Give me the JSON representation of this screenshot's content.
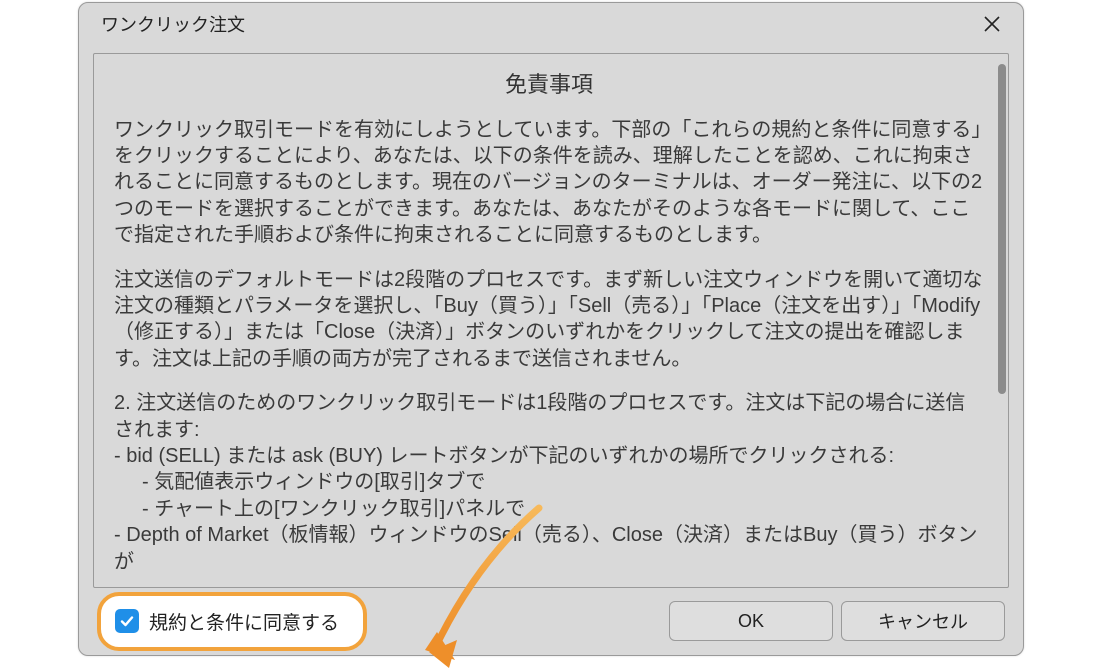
{
  "dialog": {
    "title": "ワンクリック注文",
    "heading": "免責事項",
    "paragraphs": {
      "p1": "ワンクリック取引モードを有効にしようとしています。下部の「これらの規約と条件に同意する」をクリックすることにより、あなたは、以下の条件を読み、理解したことを認め、これに拘束されることに同意するものとします。現在のバージョンのターミナルは、オーダー発注に、以下の2つのモードを選択することができます。あなたは、あなたがそのような各モードに関して、ここで指定された手順および条件に拘束されることに同意するものとします。",
      "p2": "注文送信のデフォルトモードは2段階のプロセスです。まず新しい注文ウィンドウを開いて適切な注文の種類とパラメータを選択し、「Buy（買う）」「Sell（売る）」「Place（注文を出す）」「Modify（修正する）」または「Close（決済）」ボタンのいずれかをクリックして注文の提出を確認します。注文は上記の手順の両方が完了されるまで送信されません。",
      "p3_lead": "2. 注文送信のためのワンクリック取引モードは1段階のプロセスです。注文は下記の場合に送信されます:",
      "p3_l1": "- bid (SELL) または ask (BUY) レートボタンが下記のいずれかの場所でクリックされる:",
      "p3_l1a": "- 気配値表示ウィンドウの[取引]タブで",
      "p3_l1b": "- チャート上の[ワンクリック取引]パネルで",
      "p3_l2": "- Depth of Market（板情報）ウィンドウのSell（売る）、Close（決済）またはBuy（買う）ボタンが"
    },
    "agree_label": "規約と条件に同意する",
    "ok_label": "OK",
    "cancel_label": "キャンセル"
  },
  "icons": {
    "close": "close-icon",
    "check": "check-icon",
    "arrow": "arrow-annotation"
  },
  "colors": {
    "highlight_border": "#f2a33c",
    "checkbox_bg": "#1f8fe8",
    "dialog_bg": "#d9d9d9"
  }
}
